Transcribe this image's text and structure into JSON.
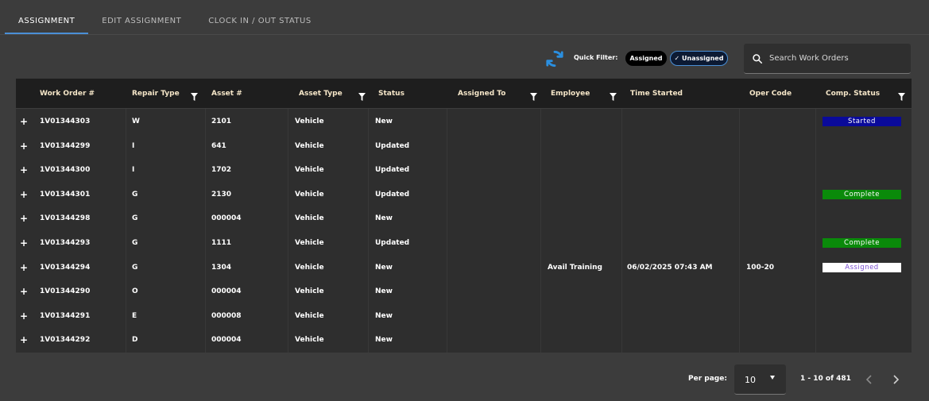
{
  "tabs": [
    {
      "label": "ASSIGNMENT",
      "active": true
    },
    {
      "label": "EDIT ASSIGNMENT",
      "active": false
    },
    {
      "label": "CLOCK IN / OUT STATUS",
      "active": false
    }
  ],
  "toolbar": {
    "quick_filter_label": "Quick Filter:",
    "chip_assigned": "Assigned",
    "chip_unassigned": "✓ Unassigned",
    "search_placeholder": "Search Work Orders"
  },
  "columns": [
    "Work Order #",
    "Repair Type",
    "Asset #",
    "Asset Type",
    "Status",
    "Assigned To",
    "Employee",
    "Time Started",
    "Oper Code",
    "Comp. Status"
  ],
  "rows": [
    {
      "wo": "1V01344303",
      "repair": "W",
      "asset": "2101",
      "type": "Vehicle",
      "status": "New",
      "assigned": "",
      "employee": "",
      "time": "",
      "oper": "",
      "comp": "Started"
    },
    {
      "wo": "1V01344299",
      "repair": "I",
      "asset": "641",
      "type": "Vehicle",
      "status": "Updated",
      "assigned": "",
      "employee": "",
      "time": "",
      "oper": "",
      "comp": ""
    },
    {
      "wo": "1V01344300",
      "repair": "I",
      "asset": "1702",
      "type": "Vehicle",
      "status": "Updated",
      "assigned": "",
      "employee": "",
      "time": "",
      "oper": "",
      "comp": ""
    },
    {
      "wo": "1V01344301",
      "repair": "G",
      "asset": "2130",
      "type": "Vehicle",
      "status": "Updated",
      "assigned": "",
      "employee": "",
      "time": "",
      "oper": "",
      "comp": "Complete"
    },
    {
      "wo": "1V01344298",
      "repair": "G",
      "asset": "000004",
      "type": "Vehicle",
      "status": "New",
      "assigned": "",
      "employee": "",
      "time": "",
      "oper": "",
      "comp": ""
    },
    {
      "wo": "1V01344293",
      "repair": "G",
      "asset": "1111",
      "type": "Vehicle",
      "status": "Updated",
      "assigned": "",
      "employee": "",
      "time": "",
      "oper": "",
      "comp": "Complete"
    },
    {
      "wo": "1V01344294",
      "repair": "G",
      "asset": "1304",
      "type": "Vehicle",
      "status": "New",
      "assigned": "",
      "employee": "Avail Training",
      "time": "06/02/2025 07:43 AM",
      "oper": "100-20",
      "comp": "Assigned"
    },
    {
      "wo": "1V01344290",
      "repair": "O",
      "asset": "000004",
      "type": "Vehicle",
      "status": "New",
      "assigned": "",
      "employee": "",
      "time": "",
      "oper": "",
      "comp": ""
    },
    {
      "wo": "1V01344291",
      "repair": "E",
      "asset": "000008",
      "type": "Vehicle",
      "status": "New",
      "assigned": "",
      "employee": "",
      "time": "",
      "oper": "",
      "comp": ""
    },
    {
      "wo": "1V01344292",
      "repair": "D",
      "asset": "000004",
      "type": "Vehicle",
      "status": "New",
      "assigned": "",
      "employee": "",
      "time": "",
      "oper": "",
      "comp": ""
    }
  ],
  "comp_status_colors": {
    "Started": {
      "bg": "#0a0a9a",
      "fg": "#ffffff"
    },
    "Complete": {
      "bg": "#0a8a0a",
      "fg": "#ffffff"
    },
    "Assigned": {
      "bg": "#ffffff",
      "fg": "#7a4fd0"
    }
  },
  "pager": {
    "per_page_label": "Per page:",
    "per_page_value": "10",
    "range_text": "1 - 10 of 481"
  },
  "icons": [
    "refresh-icon",
    "search-icon",
    "filter-icon",
    "expand-icon",
    "chevron-left-icon",
    "chevron-right-icon",
    "caret-down-icon"
  ],
  "accent_color": "#2a8fe0"
}
